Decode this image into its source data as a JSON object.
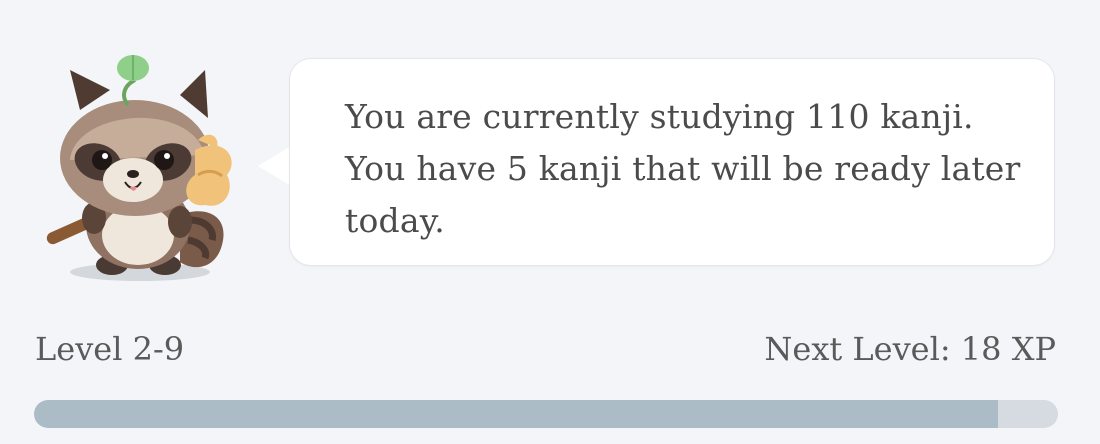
{
  "message": {
    "text": "You are currently studying 110 kanji. You have 5 kanji that will be ready later today."
  },
  "level": {
    "label": "Level 2-9",
    "next_level_label": "Next Level: 18 XP",
    "progress_fraction": 0.941
  },
  "mascot": {
    "icon": "tanuki-mascot-icon"
  },
  "colors": {
    "background": "#f3f5f8",
    "bubble": "#ffffff",
    "progress_fill": "#abbcc6",
    "progress_track": "#d5dbe1"
  }
}
